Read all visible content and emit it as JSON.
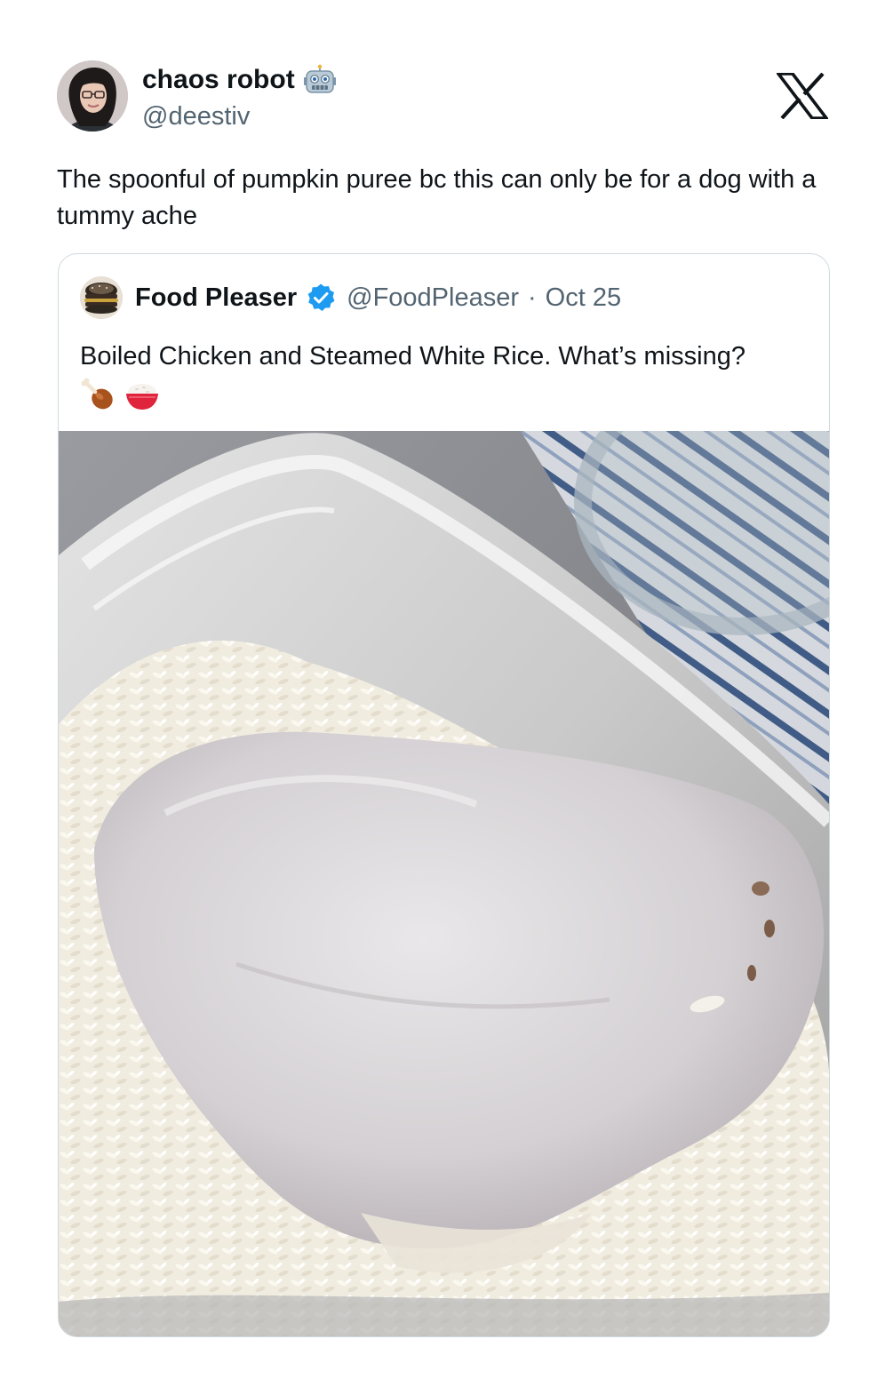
{
  "author": {
    "name": "chaos robot",
    "name_emoji_icon": "robot-face-icon",
    "handle": "@deestiv",
    "avatar_icon": "profile-avatar"
  },
  "platform_icon": "x-logo-icon",
  "tweet": {
    "text": "The spoonful of pumpkin puree bc this can only be for a dog with a tummy ache"
  },
  "quoted": {
    "name": "Food Pleaser",
    "verified_icon": "verified-badge-icon",
    "handle": "@FoodPleaser",
    "separator": "·",
    "date": "Oct 25",
    "text": "Boiled Chicken and Steamed White Rice. What’s missing?",
    "emojis": [
      "poultry-leg-icon",
      "rice-bowl-icon"
    ],
    "photo": "boiled-chicken-breast-on-white-rice-in-glass-container"
  },
  "colors": {
    "text_primary": "#0f1419",
    "text_secondary": "#536471",
    "border": "#cfd9de",
    "verified": "#1d9bf0"
  }
}
